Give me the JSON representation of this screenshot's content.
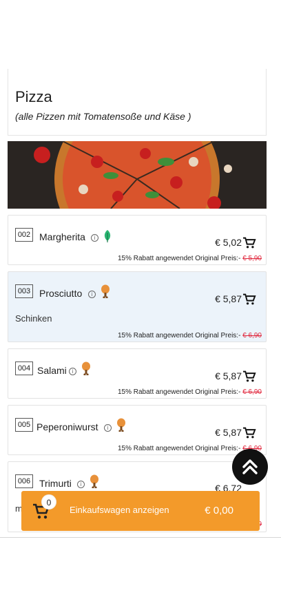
{
  "category": {
    "title": "Pizza",
    "subtitle": "(alle Pizzen mit Tomatensoße und Käse )"
  },
  "items": [
    {
      "number": "002",
      "name": "Margherita",
      "badge": "leaf-icon",
      "price": "€ 5,02",
      "discount_text": "15% Rabatt angewendet Original Preis:- ",
      "original_price": "€ 5,90"
    },
    {
      "number": "003",
      "name": "Prosciutto",
      "badge": "drumstick-icon",
      "price": "€ 5,87",
      "description": "Schinken",
      "discount_text": "15% Rabatt angewendet Original Preis:- ",
      "original_price": "€ 6,90"
    },
    {
      "number": "004",
      "name": "Salami",
      "badge": "drumstick-icon",
      "price": "€ 5,87",
      "discount_text": "15% Rabatt angewendet Original Preis:- ",
      "original_price": "€ 6,90"
    },
    {
      "number": "005",
      "name": "Peperoniwurst",
      "badge": "drumstick-icon",
      "price": "€ 5,87",
      "discount_text": "15% Rabatt angewendet Original Preis:- ",
      "original_price": "€ 6,90"
    },
    {
      "number": "006",
      "name": "Trimurti",
      "badge": "drumstick-icon",
      "price": "€ 6,72",
      "description": "m",
      "original_price": "9"
    }
  ],
  "info_glyph": "i",
  "cart": {
    "count": "0",
    "label": "Einkaufswagen anzeigen",
    "total": "€ 0,00"
  },
  "colors": {
    "accent": "#f39a2a",
    "highlight_row": "#ecf3fa",
    "strike_price": "#e0243a",
    "veg_badge": "#2bb673",
    "meat_badge": "#e8913a"
  }
}
